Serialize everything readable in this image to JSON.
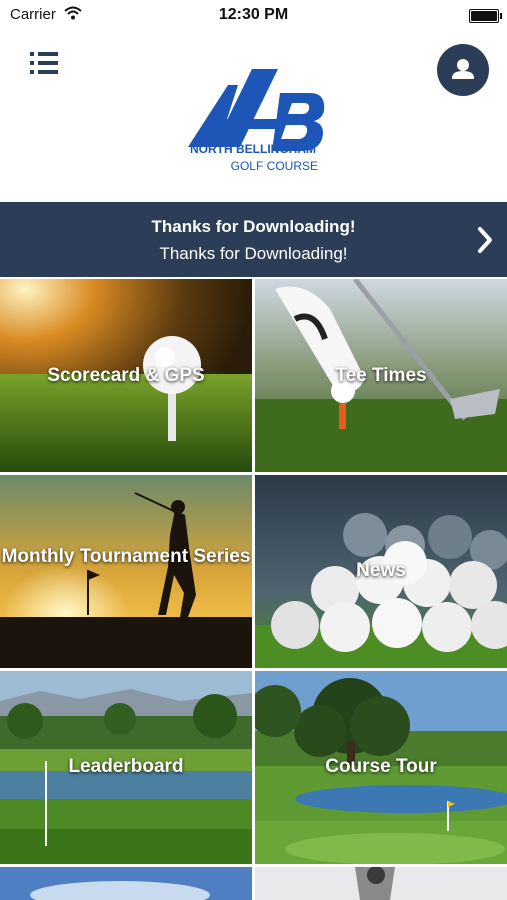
{
  "status_bar": {
    "carrier": "Carrier",
    "time": "12:30 PM"
  },
  "brand": {
    "name_line1": "NORTH BELLINGHAM",
    "name_line2": "GOLF COURSE",
    "color": "#1d56b6"
  },
  "theme": {
    "navy": "#2c3e57"
  },
  "banner": {
    "title": "Thanks for Downloading!",
    "subtitle": "Thanks for Downloading!"
  },
  "tiles": [
    {
      "label": "Scorecard & GPS"
    },
    {
      "label": "Tee Times"
    },
    {
      "label": "Monthly Tournament Series"
    },
    {
      "label": "News"
    },
    {
      "label": "Leaderboard"
    },
    {
      "label": "Course Tour"
    }
  ],
  "icons": {
    "menu": "menu-list-icon",
    "profile": "user-icon",
    "banner_arrow": "chevron-right-icon"
  }
}
